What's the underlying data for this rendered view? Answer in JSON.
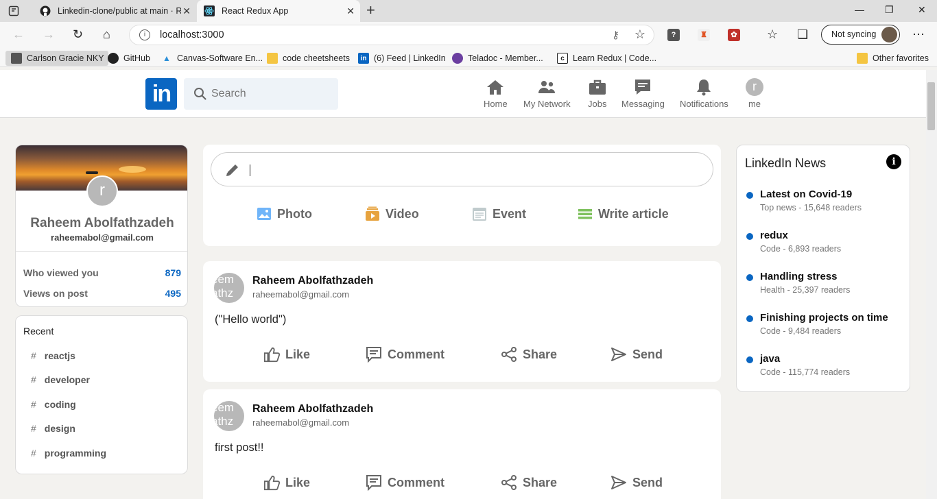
{
  "browser": {
    "tabs": [
      {
        "title": "Linkedin-clone/public at main · R",
        "icon": "github-icon"
      },
      {
        "title": "React Redux App",
        "icon": "react-icon"
      }
    ],
    "url": "localhost:3000",
    "sync_label": "Not syncing",
    "bookmarks": [
      {
        "label": "Carlson Gracie NKY"
      },
      {
        "label": "GitHub"
      },
      {
        "label": "Canvas-Software En..."
      },
      {
        "label": "code cheetsheets"
      },
      {
        "label": "(6) Feed | LinkedIn"
      },
      {
        "label": "Teladoc - Member..."
      },
      {
        "label": "Learn Redux | Code..."
      }
    ],
    "other_favorites": "Other favorites"
  },
  "header": {
    "logo": "in",
    "search_placeholder": "Search",
    "nav": [
      {
        "label": "Home",
        "icon": "home-icon"
      },
      {
        "label": "My Network",
        "icon": "network-icon"
      },
      {
        "label": "Jobs",
        "icon": "briefcase-icon"
      },
      {
        "label": "Messaging",
        "icon": "message-icon"
      },
      {
        "label": "Notifications",
        "icon": "bell-icon"
      },
      {
        "label": "me",
        "avatar": "r"
      }
    ]
  },
  "profile": {
    "avatar_letter": "r",
    "name": "Raheem Abolfathzadeh",
    "email": "raheemabol@gmail.com",
    "stats": [
      {
        "label": "Who viewed you",
        "value": "879"
      },
      {
        "label": "Views on post",
        "value": "495"
      }
    ]
  },
  "recent": {
    "title": "Recent",
    "hash": "#",
    "tags": [
      "reactjs",
      "developer",
      "coding",
      "design",
      "programming"
    ]
  },
  "share": {
    "buttons": [
      {
        "label": "Photo",
        "icon": "photo-icon",
        "color": "#70b5f9"
      },
      {
        "label": "Video",
        "icon": "video-icon",
        "color": "#e7a33e"
      },
      {
        "label": "Event",
        "icon": "event-icon",
        "color": "#c0cbcd"
      },
      {
        "label": "Write article",
        "icon": "article-icon",
        "color": "#7fc15e"
      }
    ]
  },
  "posts": [
    {
      "avatar_text": "eem athz",
      "name": "Raheem Abolfathzadeh",
      "email": "raheemabol@gmail.com",
      "text": "(\"Hello world\")"
    },
    {
      "avatar_text": "eem athz",
      "name": "Raheem Abolfathzadeh",
      "email": "raheemabol@gmail.com",
      "text": "first post!!"
    }
  ],
  "post_actions": [
    "Like",
    "Comment",
    "Share",
    "Send"
  ],
  "news": {
    "title": "LinkedIn News",
    "info": "i",
    "items": [
      {
        "title": "Latest on Covid-19",
        "sub": "Top news - 15,648 readers"
      },
      {
        "title": "redux",
        "sub": "Code - 6,893 readers"
      },
      {
        "title": "Handling stress",
        "sub": "Health - 25,397 readers"
      },
      {
        "title": "Finishing projects on time",
        "sub": "Code - 9,484 readers"
      },
      {
        "title": "java",
        "sub": "Code - 115,774 readers"
      }
    ]
  }
}
